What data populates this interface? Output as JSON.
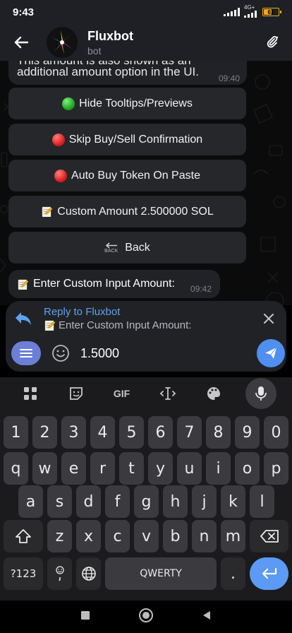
{
  "status_bar": {
    "time": "9:43",
    "network": "4G+",
    "battery": "61"
  },
  "header": {
    "title": "Fluxbot",
    "subtitle": "bot"
  },
  "messages": {
    "top_line1": "This amount is also shown as an",
    "top_line2": "additional amount option in the UI.",
    "top_time": "09:40",
    "bottom_text": "Enter Custom Input Amount:",
    "bottom_time": "09:42"
  },
  "keyboard_buttons": [
    {
      "label": "Hide Tooltips/Previews",
      "icon": "green-circle"
    },
    {
      "label": "Skip Buy/Sell Confirmation",
      "icon": "red-circle"
    },
    {
      "label": "Auto Buy Token On Paste",
      "icon": "red-circle"
    },
    {
      "label": "Custom Amount 2.500000 SOL",
      "icon": "memo"
    },
    {
      "label": "Back",
      "icon": "back-arrow",
      "icon_text": "BACK"
    }
  ],
  "reply": {
    "title": "Reply to Fluxbot",
    "text": "Enter Custom Input Amount:"
  },
  "input": {
    "value": "1.5000"
  },
  "keyboard": {
    "toolbar": {
      "gif": "GIF"
    },
    "row_numbers": [
      "1",
      "2",
      "3",
      "4",
      "5",
      "6",
      "7",
      "8",
      "9",
      "0"
    ],
    "row1": [
      "q",
      "w",
      "e",
      "r",
      "t",
      "y",
      "u",
      "i",
      "o",
      "p"
    ],
    "row2": [
      "a",
      "s",
      "d",
      "f",
      "g",
      "h",
      "j",
      "k",
      "l"
    ],
    "row3": [
      "z",
      "x",
      "c",
      "v",
      "b",
      "n",
      "m"
    ],
    "symbols": "?123",
    "space": "QWERTY",
    "period": "."
  },
  "colors": {
    "accent": "#5ea2ef",
    "send": "#4e8ff0",
    "menu_button": "#6b7fd7",
    "battery": "#f5a623"
  }
}
